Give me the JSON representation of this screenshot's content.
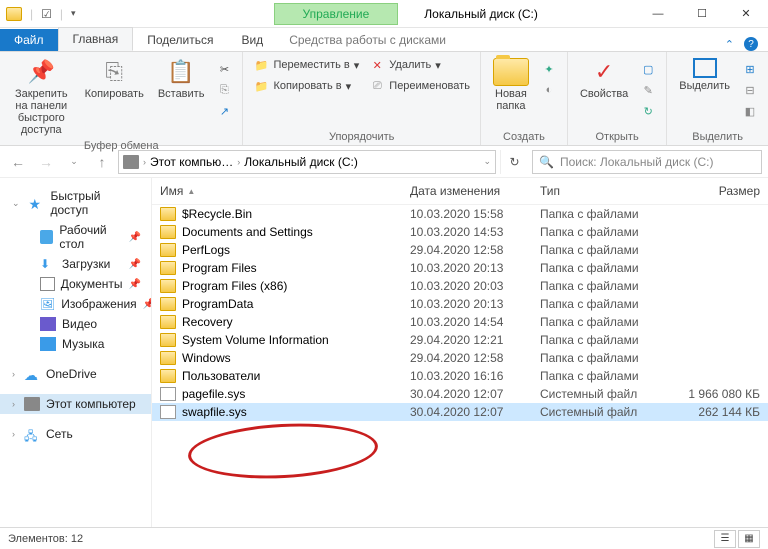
{
  "titlebar": {
    "manage": "Управление",
    "title": "Локальный диск (C:)"
  },
  "tabs": {
    "file": "Файл",
    "home": "Главная",
    "share": "Поделиться",
    "view": "Вид",
    "context": "Средства работы с дисками"
  },
  "ribbon": {
    "pin": "Закрепить на панели\nбыстрого доступа",
    "copy": "Копировать",
    "paste": "Вставить",
    "clipboard": "Буфер обмена",
    "moveto": "Переместить в",
    "copyto": "Копировать в",
    "delete": "Удалить",
    "rename": "Переименовать",
    "organize": "Упорядочить",
    "newfolder": "Новая\nпапка",
    "create": "Создать",
    "props": "Свойства",
    "open": "Открыть",
    "select": "Выделить",
    "selectgrp": "Выделить"
  },
  "addr": {
    "pc": "Этот компью…",
    "drive": "Локальный диск (C:)",
    "search_ph": "Поиск: Локальный диск (C:)"
  },
  "nav": {
    "quick": "Быстрый доступ",
    "desktop": "Рабочий стол",
    "downloads": "Загрузки",
    "documents": "Документы",
    "pictures": "Изображения",
    "video": "Видео",
    "music": "Музыка",
    "onedrive": "OneDrive",
    "thispc": "Этот компьютер",
    "network": "Сеть"
  },
  "cols": {
    "name": "Имя",
    "date": "Дата изменения",
    "type": "Тип",
    "size": "Размер"
  },
  "files": [
    {
      "name": "$Recycle.Bin",
      "date": "10.03.2020 15:58",
      "type": "Папка с файлами",
      "size": "",
      "icon": "folder"
    },
    {
      "name": "Documents and Settings",
      "date": "10.03.2020 14:53",
      "type": "Папка с файлами",
      "size": "",
      "icon": "folder"
    },
    {
      "name": "PerfLogs",
      "date": "29.04.2020 12:58",
      "type": "Папка с файлами",
      "size": "",
      "icon": "folder"
    },
    {
      "name": "Program Files",
      "date": "10.03.2020 20:13",
      "type": "Папка с файлами",
      "size": "",
      "icon": "folder"
    },
    {
      "name": "Program Files (x86)",
      "date": "10.03.2020 20:03",
      "type": "Папка с файлами",
      "size": "",
      "icon": "folder"
    },
    {
      "name": "ProgramData",
      "date": "10.03.2020 20:13",
      "type": "Папка с файлами",
      "size": "",
      "icon": "folder"
    },
    {
      "name": "Recovery",
      "date": "10.03.2020 14:54",
      "type": "Папка с файлами",
      "size": "",
      "icon": "folder"
    },
    {
      "name": "System Volume Information",
      "date": "29.04.2020 12:21",
      "type": "Папка с файлами",
      "size": "",
      "icon": "folder"
    },
    {
      "name": "Windows",
      "date": "29.04.2020 12:58",
      "type": "Папка с файлами",
      "size": "",
      "icon": "folder"
    },
    {
      "name": "Пользователи",
      "date": "10.03.2020 16:16",
      "type": "Папка с файлами",
      "size": "",
      "icon": "folder"
    },
    {
      "name": "pagefile.sys",
      "date": "30.04.2020 12:07",
      "type": "Системный файл",
      "size": "1 966 080 КБ",
      "icon": "file"
    },
    {
      "name": "swapfile.sys",
      "date": "30.04.2020 12:07",
      "type": "Системный файл",
      "size": "262 144 КБ",
      "icon": "file",
      "sel": true
    }
  ],
  "status": {
    "count": "Элементов: 12"
  }
}
